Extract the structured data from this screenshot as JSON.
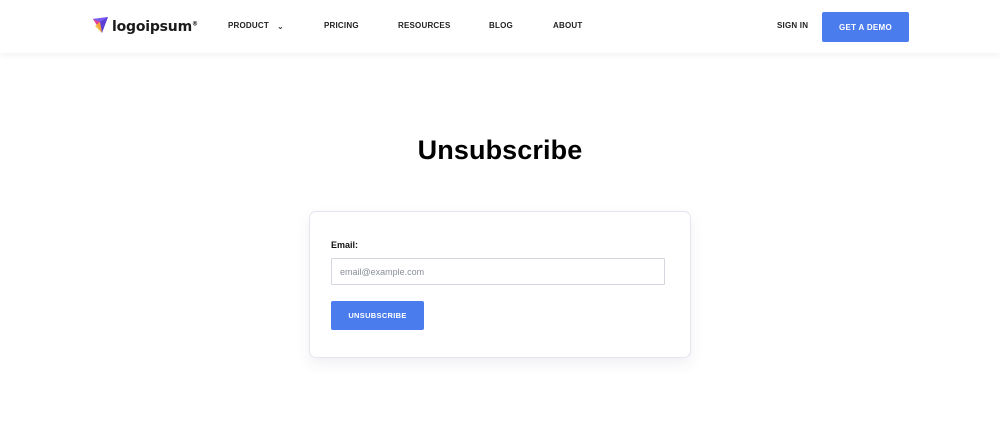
{
  "header": {
    "logo_text": "logoipsum",
    "logo_mark": "®",
    "nav": [
      {
        "label": "PRODUCT",
        "icon": "chevron-down-icon"
      },
      {
        "label": "PRICING"
      },
      {
        "label": "RESOURCES"
      },
      {
        "label": "BLOG"
      },
      {
        "label": "ABOUT"
      }
    ],
    "sign_in_label": "SIGN IN",
    "demo_label": "GET A DEMO"
  },
  "main": {
    "title": "Unsubscribe",
    "form": {
      "email_label": "Email:",
      "email_placeholder": "email@example.com",
      "email_value": "",
      "submit_label": "UNSUBSCRIBE"
    }
  },
  "colors": {
    "accent": "#4a7ced",
    "logo_purple": "#5b3fd6",
    "logo_pink": "#e84393",
    "logo_yellow": "#f5b82e"
  }
}
